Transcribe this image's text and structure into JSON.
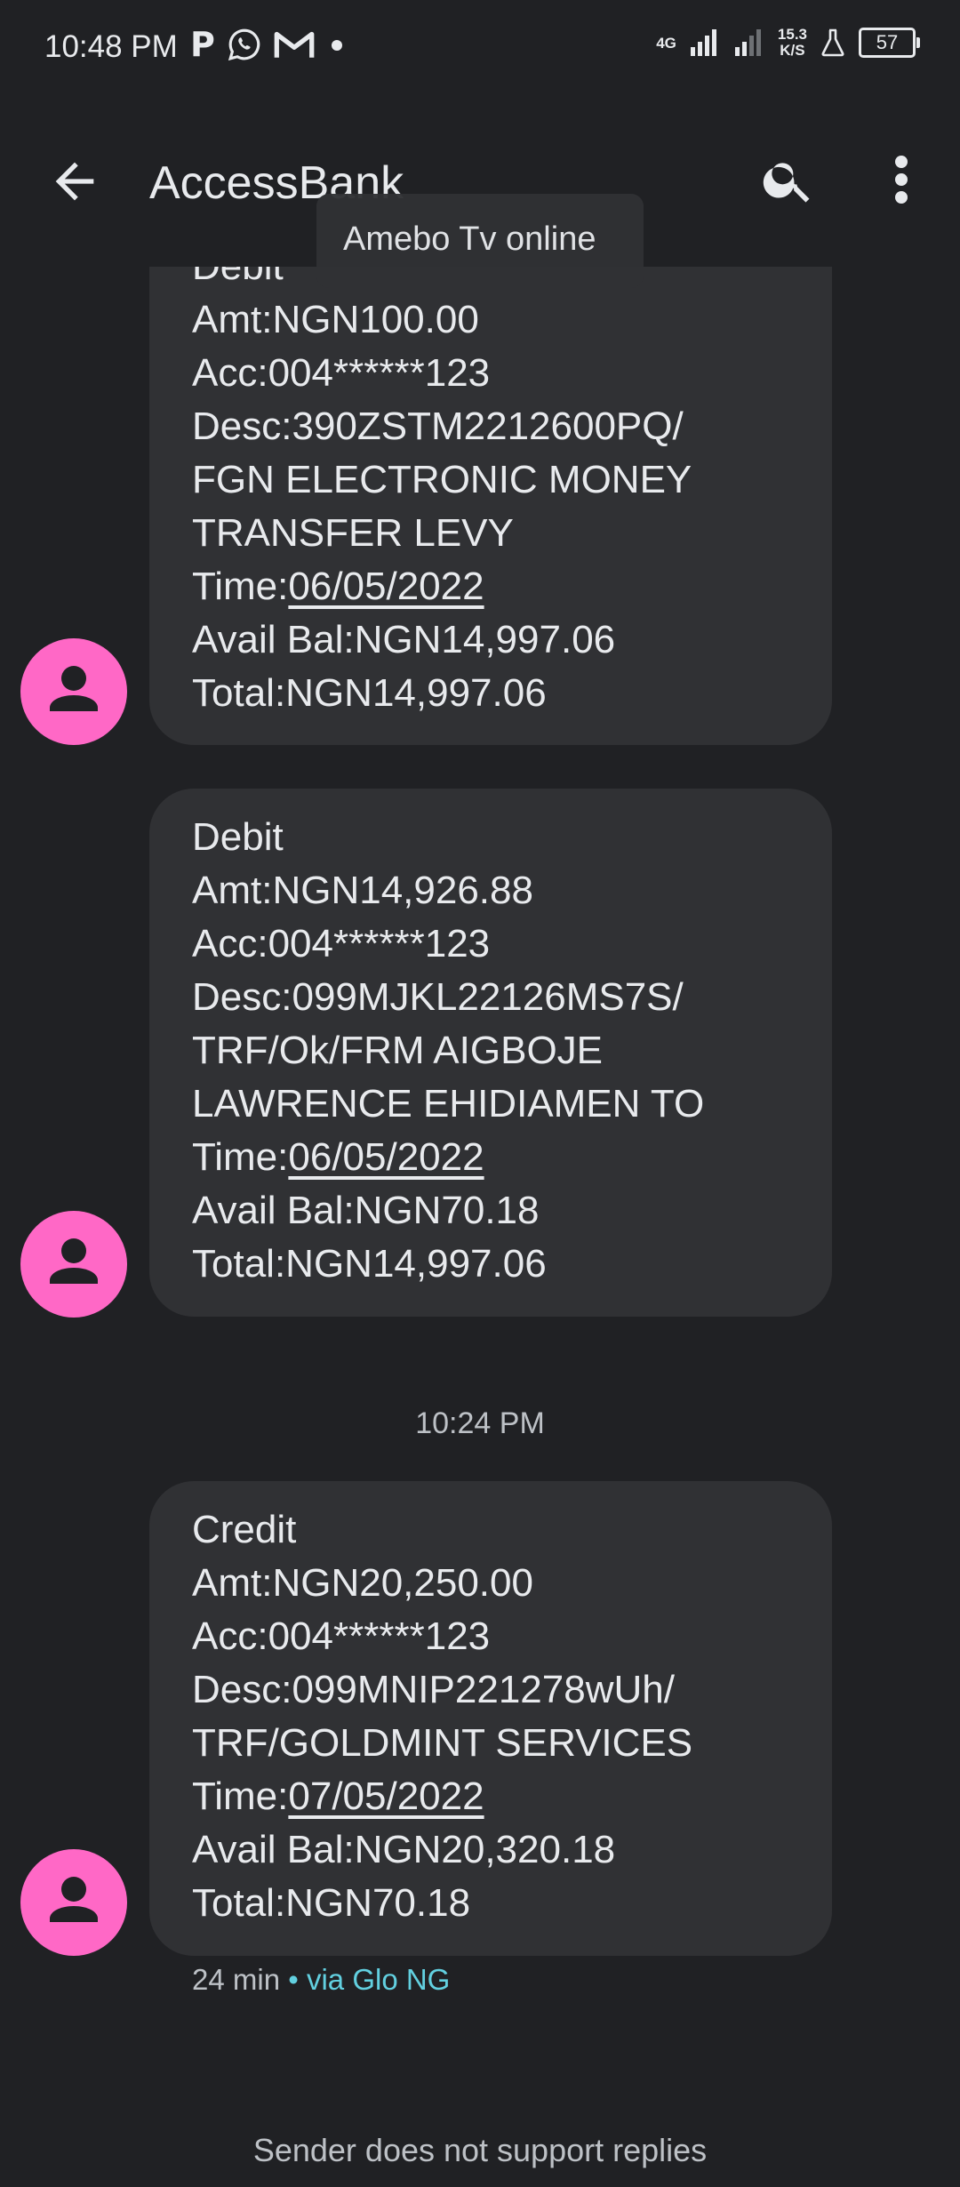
{
  "status_bar": {
    "time": "10:48 PM",
    "app_icons": [
      "P",
      "whatsapp-icon",
      "gmail-icon",
      "dot-icon"
    ],
    "network": "4G",
    "speed_value": "15.3",
    "speed_unit": "K/S",
    "battery": "57"
  },
  "app_bar": {
    "title": "AccessBank",
    "toast": "Amebo Tv online"
  },
  "messages": [
    {
      "lines": [
        "Debit",
        "Amt:NGN100.00",
        "Acc:004******123",
        "Desc:390ZSTM2212600PQ/",
        "FGN ELECTRONIC MONEY",
        "TRANSFER LEVY"
      ],
      "time_prefix": "Time:",
      "time_date": "06/05/2022",
      "balance": "Avail Bal:NGN14,997.06",
      "total": "Total:NGN14,997.06"
    },
    {
      "lines": [
        "Debit",
        "Amt:NGN14,926.88",
        "Acc:004******123",
        "Desc:099MJKL22126MS7S/",
        "TRF/Ok/FRM AIGBOJE",
        "LAWRENCE EHIDIAMEN TO"
      ],
      "time_prefix": "Time:",
      "time_date": "06/05/2022",
      "balance": "Avail Bal:NGN70.18",
      "total": "Total:NGN14,997.06"
    },
    {
      "lines": [
        "Credit",
        "Amt:NGN20,250.00",
        "Acc:004******123",
        "Desc:099MNIP221278wUh/",
        "TRF/GOLDMINT SERVICES"
      ],
      "time_prefix": "Time:",
      "time_date": "07/05/2022",
      "balance": "Avail Bal:NGN20,320.18",
      "total": "Total:NGN70.18"
    }
  ],
  "timestamp": "10:24 PM",
  "meta": {
    "age": "24 min",
    "separator": "•",
    "via": "via Glo NG"
  },
  "footer": "Sender does not support replies"
}
